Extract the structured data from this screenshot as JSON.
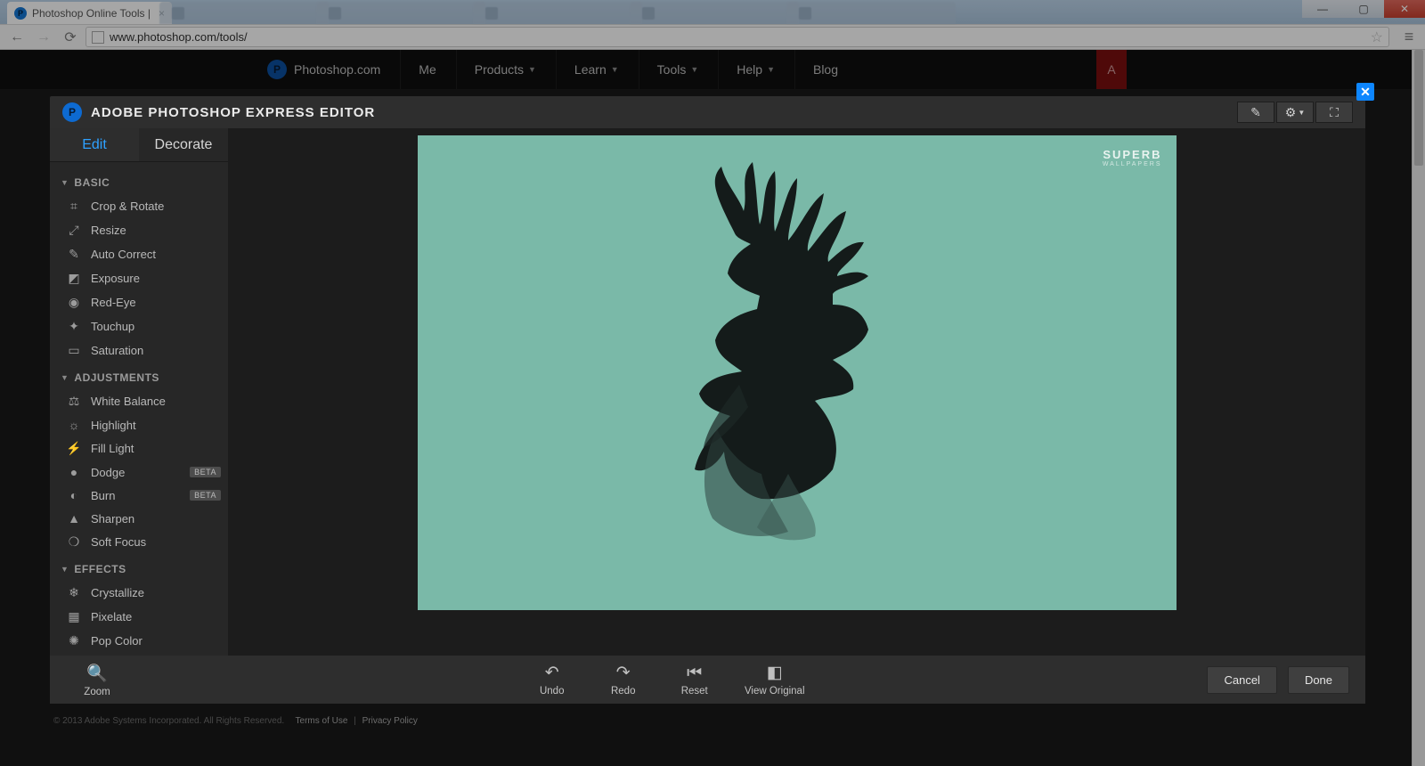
{
  "browser": {
    "active_tab_title": "Photoshop Online Tools | ",
    "url": "www.photoshop.com/tools/"
  },
  "site_nav": {
    "brand": "Photoshop.com",
    "items": [
      "Me",
      "Products",
      "Learn",
      "Tools",
      "Help",
      "Blog"
    ]
  },
  "editor": {
    "title": "ADOBE PHOTOSHOP EXPRESS EDITOR",
    "tabs": {
      "edit": "Edit",
      "decorate": "Decorate"
    },
    "groups": [
      {
        "name": "BASIC",
        "tools": [
          {
            "icon": "⌗",
            "label": "Crop & Rotate"
          },
          {
            "icon": "⤢",
            "label": "Resize"
          },
          {
            "icon": "✎",
            "label": "Auto Correct"
          },
          {
            "icon": "◩",
            "label": "Exposure"
          },
          {
            "icon": "◉",
            "label": "Red-Eye"
          },
          {
            "icon": "✦",
            "label": "Touchup"
          },
          {
            "icon": "▭",
            "label": "Saturation"
          }
        ]
      },
      {
        "name": "ADJUSTMENTS",
        "tools": [
          {
            "icon": "⚖",
            "label": "White Balance"
          },
          {
            "icon": "☼",
            "label": "Highlight"
          },
          {
            "icon": "⚡",
            "label": "Fill Light"
          },
          {
            "icon": "●",
            "label": "Dodge",
            "badge": "BETA"
          },
          {
            "icon": "◐",
            "label": "Burn",
            "badge": "BETA"
          },
          {
            "icon": "▲",
            "label": "Sharpen"
          },
          {
            "icon": "❍",
            "label": "Soft Focus"
          }
        ]
      },
      {
        "name": "EFFECTS",
        "tools": [
          {
            "icon": "❄",
            "label": "Crystallize"
          },
          {
            "icon": "▦",
            "label": "Pixelate"
          },
          {
            "icon": "✺",
            "label": "Pop Color"
          }
        ]
      }
    ],
    "watermark": {
      "line1": "SUPERB",
      "line2": "WALLPAPERS"
    },
    "footer": {
      "zoom": "Zoom",
      "undo": "Undo",
      "redo": "Redo",
      "reset": "Reset",
      "view_original": "View Original",
      "cancel": "Cancel",
      "done": "Done"
    }
  },
  "page_footer": {
    "copyright": "© 2013 Adobe Systems Incorporated. All Rights Reserved.",
    "links": [
      "Terms of Use",
      "Privacy Policy"
    ]
  }
}
